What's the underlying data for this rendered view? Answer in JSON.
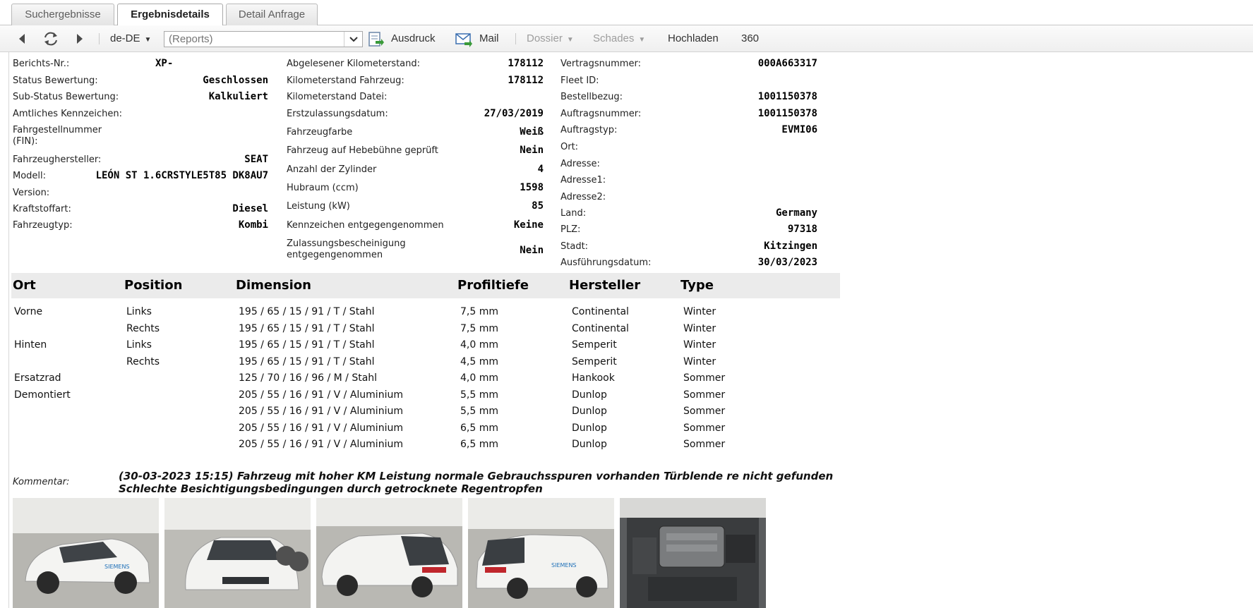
{
  "tabs": [
    {
      "label": "Suchergebnisse",
      "active": false
    },
    {
      "label": "Ergebnisdetails",
      "active": true
    },
    {
      "label": "Detail Anfrage",
      "active": false
    }
  ],
  "toolbar": {
    "language": "de-DE",
    "reports_placeholder": "(Reports)",
    "print_label": "Ausdruck",
    "mail_label": "Mail",
    "dossier_label": "Dossier",
    "schades_label": "Schades",
    "upload_label": "Hochladen",
    "view_360_label": "360",
    "icons": [
      "back-arrow-icon",
      "refresh-icon",
      "forward-arrow-icon",
      "print-icon",
      "mail-icon"
    ]
  },
  "details": {
    "col1": [
      {
        "label": "Berichts-Nr.:",
        "value": "XP-"
      },
      {
        "label": "Status Bewertung:",
        "value": "Geschlossen"
      },
      {
        "label": "Sub-Status Bewertung:",
        "value": "Kalkuliert"
      },
      {
        "label": "Amtliches Kennzeichen:",
        "value": ""
      },
      {
        "label": "Fahrgestellnummer (FIN):",
        "value": ""
      },
      {
        "label": "Fahrzeughersteller:",
        "value": "SEAT"
      },
      {
        "label": "Modell:",
        "value": "LEÓN ST 1.6CRSTYLE5T85 DK8AU7"
      },
      {
        "label": "Version:",
        "value": ""
      },
      {
        "label": "Kraftstoffart:",
        "value": "Diesel"
      },
      {
        "label": "Fahrzeugtyp:",
        "value": "Kombi"
      }
    ],
    "col2": [
      {
        "label": "Abgelesener Kilometerstand:",
        "value": "178112"
      },
      {
        "label": "Kilometerstand Fahrzeug:",
        "value": "178112"
      },
      {
        "label": "Kilometerstand Datei:",
        "value": ""
      },
      {
        "label": "Erstzulassungsdatum:",
        "value": "27/03/2019"
      },
      {
        "label": "Fahrzeugfarbe",
        "value": "Weiß"
      },
      {
        "label": "Fahrzeug auf Hebebühne geprüft",
        "value": "Nein"
      },
      {
        "label": "Anzahl der Zylinder",
        "value": "4"
      },
      {
        "label": "Hubraum (ccm)",
        "value": "1598"
      },
      {
        "label": "Leistung (kW)",
        "value": "85"
      },
      {
        "label": "Kennzeichen entgegengenommen",
        "value": "Keine"
      },
      {
        "label": "Zulassungsbescheinigung entgegengenommen",
        "value": "Nein"
      }
    ],
    "col3": [
      {
        "label": "Vertragsnummer:",
        "value": "000A663317"
      },
      {
        "label": "Fleet ID:",
        "value": ""
      },
      {
        "label": "Bestellbezug:",
        "value": "1001150378"
      },
      {
        "label": "Auftragsnummer:",
        "value": "1001150378"
      },
      {
        "label": "Auftragstyp:",
        "value": "EVMI06"
      },
      {
        "label": "Ort:",
        "value": ""
      },
      {
        "label": "Adresse:",
        "value": ""
      },
      {
        "label": "Adresse1:",
        "value": ""
      },
      {
        "label": "Adresse2:",
        "value": ""
      },
      {
        "label": "Land:",
        "value": "Germany"
      },
      {
        "label": "PLZ:",
        "value": "97318"
      },
      {
        "label": "Stadt:",
        "value": "Kitzingen"
      },
      {
        "label": "Ausführungsdatum:",
        "value": "30/03/2023"
      }
    ]
  },
  "tyres": {
    "headers": [
      "Ort",
      "Position",
      "Dimension",
      "Profiltiefe",
      "Hersteller",
      "Type"
    ],
    "rows": [
      [
        "Vorne",
        "Links",
        "195 / 65 / 15 / 91 / T / Stahl",
        "7,5 mm",
        "Continental",
        "Winter"
      ],
      [
        "",
        "Rechts",
        "195 / 65 / 15 / 91 / T / Stahl",
        "7,5 mm",
        "Continental",
        "Winter"
      ],
      [
        "Hinten",
        "Links",
        "195 / 65 / 15 / 91 / T / Stahl",
        "4,0 mm",
        "Semperit",
        "Winter"
      ],
      [
        "",
        "Rechts",
        "195 / 65 / 15 / 91 / T / Stahl",
        "4,5 mm",
        "Semperit",
        "Winter"
      ],
      [
        "Ersatzrad",
        "",
        "125 / 70 / 16 / 96 / M / Stahl",
        "4,0 mm",
        "Hankook",
        "Sommer"
      ],
      [
        "Demontiert",
        "",
        "205 / 55 / 16 / 91 / V / Aluminium",
        "5,5 mm",
        "Dunlop",
        "Sommer"
      ],
      [
        "",
        "",
        "205 / 55 / 16 / 91 / V / Aluminium",
        "5,5 mm",
        "Dunlop",
        "Sommer"
      ],
      [
        "",
        "",
        "205 / 55 / 16 / 91 / V / Aluminium",
        "6,5 mm",
        "Dunlop",
        "Sommer"
      ],
      [
        "",
        "",
        "205 / 55 / 16 / 91 / V / Aluminium",
        "6,5 mm",
        "Dunlop",
        "Sommer"
      ]
    ]
  },
  "comment": {
    "label": "Kommentar:",
    "text": "(30-03-2023 15:15) Fahrzeug mit hoher KM Leistung normale Gebrauchsspuren vorhanden Türblende re nicht gefunden Schlechte Besichtigungsbedingungen durch getrocknete Regentropfen"
  },
  "photos": [
    "front-left",
    "front",
    "rear-left",
    "rear-right",
    "engine"
  ],
  "colors": {
    "accent_green": "#3a9a3a",
    "mail_blue": "#3b6fb0",
    "header_bg": "#ebebeb"
  }
}
